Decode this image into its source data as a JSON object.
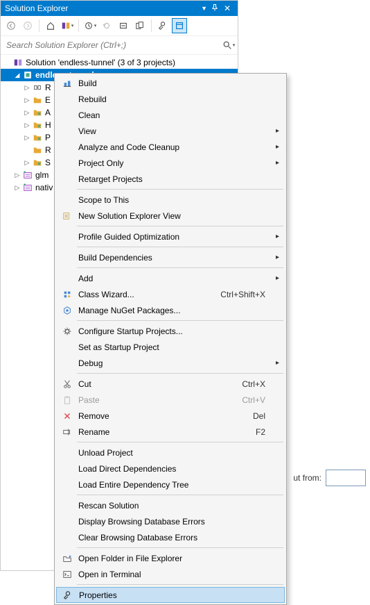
{
  "panel": {
    "title": "Solution Explorer",
    "search_placeholder": "Search Solution Explorer (Ctrl+;)"
  },
  "tree": {
    "solution_label": "Solution 'endless-tunnel' (3 of 3 projects)",
    "project": "endless-tunnel",
    "items": [
      "R",
      "E",
      "A",
      "H",
      "P",
      "R",
      "S"
    ],
    "glm": "glm",
    "native": "nativ"
  },
  "menu": {
    "build": "Build",
    "rebuild": "Rebuild",
    "clean": "Clean",
    "view": "View",
    "analyze": "Analyze and Code Cleanup",
    "project_only": "Project Only",
    "retarget": "Retarget Projects",
    "scope": "Scope to This",
    "new_view": "New Solution Explorer View",
    "pgo": "Profile Guided Optimization",
    "build_deps": "Build Dependencies",
    "add": "Add",
    "class_wizard": "Class Wizard...",
    "class_wizard_short": "Ctrl+Shift+X",
    "nuget": "Manage NuGet Packages...",
    "configure_startup": "Configure Startup Projects...",
    "set_startup": "Set as Startup Project",
    "debug": "Debug",
    "cut": "Cut",
    "cut_short": "Ctrl+X",
    "paste": "Paste",
    "paste_short": "Ctrl+V",
    "remove": "Remove",
    "remove_short": "Del",
    "rename": "Rename",
    "rename_short": "F2",
    "unload": "Unload Project",
    "load_direct": "Load Direct Dependencies",
    "load_tree": "Load Entire Dependency Tree",
    "rescan": "Rescan Solution",
    "disp_errors": "Display Browsing Database Errors",
    "clear_errors": "Clear Browsing Database Errors",
    "open_folder": "Open Folder in File Explorer",
    "open_terminal": "Open in Terminal",
    "properties": "Properties"
  },
  "bg": {
    "label": "ut from:"
  }
}
